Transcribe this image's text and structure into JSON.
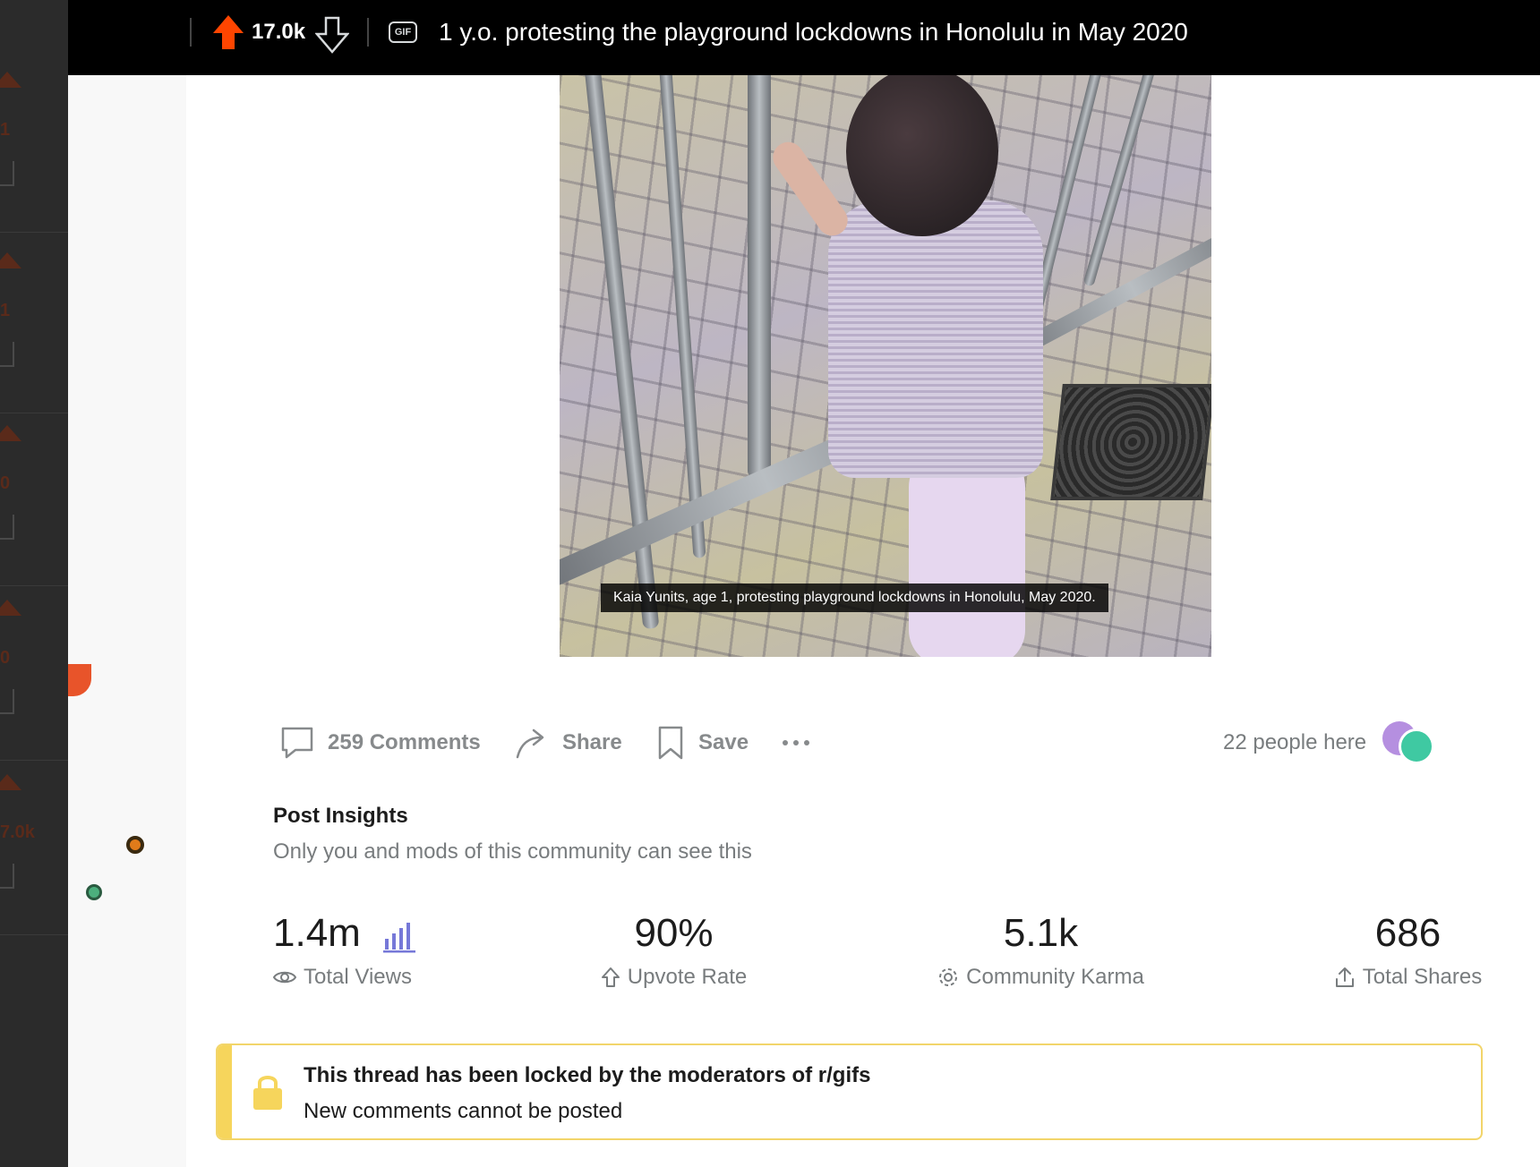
{
  "post": {
    "score": "17.0k",
    "media_type": "GIF",
    "title": "1 y.o. protesting the playground lockdowns in Honolulu in May 2020",
    "caption": "Kaia Yunits, age 1, protesting playground lockdowns in Honolulu, May 2020."
  },
  "actions": {
    "comments_label": "259 Comments",
    "share_label": "Share",
    "save_label": "Save",
    "people_here": "22 people here"
  },
  "insights": {
    "title": "Post Insights",
    "subtitle": "Only you and mods of this community can see this",
    "stats": [
      {
        "value": "1.4m",
        "label": "Total Views",
        "icon": "eye-icon"
      },
      {
        "value": "90%",
        "label": "Upvote Rate",
        "icon": "upvote-outline-icon"
      },
      {
        "value": "5.1k",
        "label": "Community Karma",
        "icon": "karma-icon"
      },
      {
        "value": "686",
        "label": "Total Shares",
        "icon": "share-upload-icon"
      }
    ]
  },
  "locked": {
    "title": "This thread has been locked by the moderators of r/gifs",
    "subtitle": "New comments cannot be posted"
  },
  "colors": {
    "upvote": "#ff4500",
    "topbar": "#000000",
    "lock": "#f6d55c",
    "accent_bars": "#7678d8"
  },
  "left_feed": {
    "scores": [
      "1",
      "1",
      "0",
      "0",
      "7.0k"
    ]
  }
}
